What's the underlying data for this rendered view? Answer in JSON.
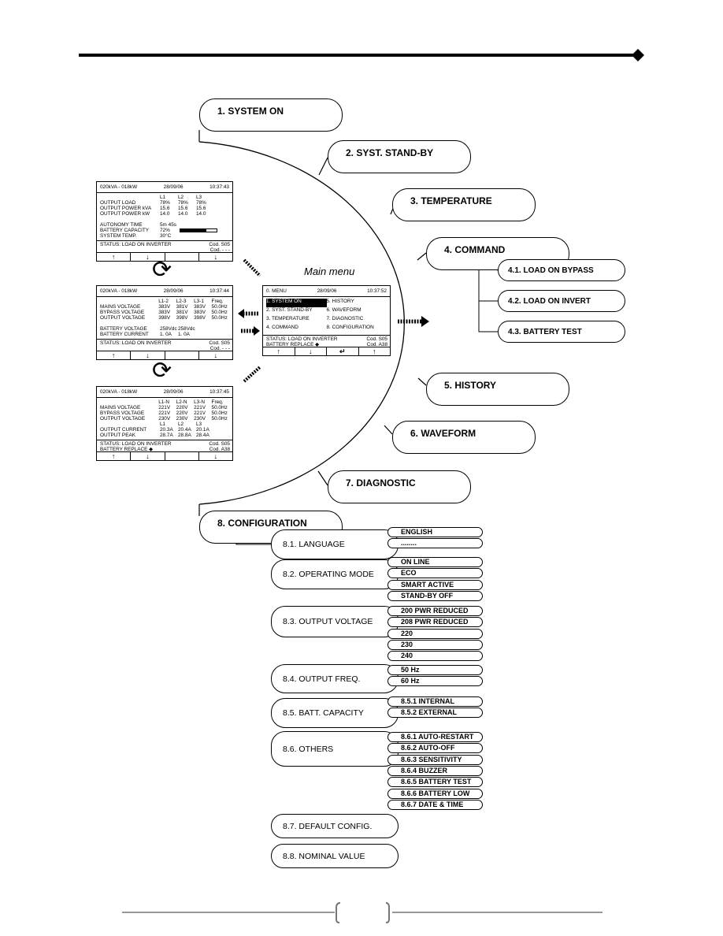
{
  "menu": {
    "title": "Main menu",
    "items": [
      {
        "label": "1. SYSTEM ON"
      },
      {
        "label": "2. SYST. STAND-BY"
      },
      {
        "label": "3. TEMPERATURE"
      },
      {
        "label": "4. COMMAND"
      },
      {
        "label": "5. HISTORY"
      },
      {
        "label": "6. WAVEFORM"
      },
      {
        "label": "7. DIAGNOSTIC"
      },
      {
        "label": "8.  CONFIGURATION"
      }
    ],
    "command_sub": [
      "4.1. LOAD ON BYPASS",
      "4.2. LOAD ON INVERT",
      "4.3. BATTERY TEST"
    ]
  },
  "configuration": [
    {
      "label": "8.1.  LANGUAGE",
      "options": [
        "ENGLISH",
        "........"
      ]
    },
    {
      "label": "8.2.  OPERATING MODE",
      "options": [
        "ON LINE",
        "ECO",
        "SMART ACTIVE",
        "STAND-BY OFF"
      ]
    },
    {
      "label": "8.3.  OUTPUT VOLTAGE",
      "options": [
        "200 PWR REDUCED",
        "208 PWR REDUCED",
        "220",
        "230",
        "240"
      ]
    },
    {
      "label": "8.4.  OUTPUT FREQ.",
      "options": [
        "50 Hz",
        "60 Hz"
      ]
    },
    {
      "label": "8.5.  BATT. CAPACITY",
      "options": [
        "8.5.1 INTERNAL",
        "8.5.2 EXTERNAL"
      ]
    },
    {
      "label": "8.6.  OTHERS",
      "options": [
        "8.6.1 AUTO-RESTART",
        "8.6.2 AUTO-OFF",
        "8.6.3 SENSITIVITY",
        "8.6.4 BUZZER",
        "8.6.5 BATTERY TEST",
        "8.6.6 BATTERY LOW",
        "8.6.7 DATE & TIME"
      ]
    },
    {
      "label": "8.7.  DEFAULT CONFIG.",
      "options": []
    },
    {
      "label": "8.8.  NOMINAL VALUE",
      "options": []
    }
  ],
  "screens": [
    {
      "header": [
        "020kVA - 018kW",
        "28/09/06",
        "10:37:43"
      ],
      "rows": [
        [
          "",
          "L1",
          "L2",
          "L3"
        ],
        [
          "OUTPUT LOAD",
          "78%",
          "78%",
          "78%"
        ],
        [
          "OUTPUT POWER kVA",
          "15.6",
          "15.6",
          "15.6"
        ],
        [
          "OUTPUT POWER kW",
          "14.0",
          "14.0",
          "14.0"
        ],
        [
          ""
        ],
        [
          "AUTONOMY TIME",
          "5m  45s"
        ],
        [
          "BATTERY CAPACITY",
          "72%"
        ],
        [
          "SYSTEM TEMP.",
          "30°C"
        ]
      ],
      "battery_capacity_percent": 72,
      "status": [
        "STATUS:  LOAD ON INVERTER",
        ""
      ],
      "cod": [
        "Cod.  S05",
        "Cod.  - - -"
      ]
    },
    {
      "header": [
        "020kVA - 018kW",
        "28/09/06",
        "10:37:44"
      ],
      "rows": [
        [
          "",
          "L1-2",
          "L2-3",
          "L3-1",
          "Freq."
        ],
        [
          "MAINS   VOLTAGE",
          "383V",
          "381V",
          "383V",
          "50.0Hz"
        ],
        [
          "BYPASS  VOLTAGE",
          "383V",
          "381V",
          "383V",
          "50.0Hz"
        ],
        [
          "OUTPUT  VOLTAGE",
          "398V",
          "398V",
          "398V",
          "50.0Hz"
        ],
        [
          ""
        ],
        [
          "BATTERY VOLTAGE",
          "258Vdc",
          "258Vdc"
        ],
        [
          "BATTERY CURRENT",
          "1. 0A",
          "1. 0A"
        ]
      ],
      "status": [
        "STATUS:  LOAD ON INVERTER",
        ""
      ],
      "cod": [
        "Cod.  S05",
        "Cod.  - - -"
      ]
    },
    {
      "header": [
        "020kVA - 018kW",
        "28/09/06",
        "10:37:45"
      ],
      "rows": [
        [
          "",
          "L1-N",
          "L2-N",
          "L3-N",
          "Freq."
        ],
        [
          "MAINS   VOLTAGE",
          "221V",
          "220V",
          "221V",
          "50.0Hz"
        ],
        [
          "BYPASS  VOLTAGE",
          "221V",
          "220V",
          "221V",
          "50.0Hz"
        ],
        [
          "OUTPUT  VOLTAGE",
          "230V",
          "230V",
          "230V",
          "50.0Hz"
        ],
        [
          "",
          "L1",
          "L2",
          "L3"
        ],
        [
          "OUTPUT  CURRENT",
          "20.3A",
          "20.4A",
          "20.1A"
        ],
        [
          "OUTPUT  PEAK",
          "28.7A",
          "28.8A",
          "28.4A"
        ]
      ],
      "status": [
        "STATUS:  LOAD ON INVERTER",
        "BATTERY REPLACE ◆"
      ],
      "cod": [
        "Cod.  S05",
        "Cod.  A38"
      ]
    }
  ],
  "main_screen": {
    "header": [
      "0. MENU",
      "28/09/06",
      "10:37:52"
    ],
    "rows": [
      [
        "1. SYSTEM ON",
        "5. HISTORY"
      ],
      [
        "2. SYST. STAND-BY",
        "6. WAVEFORM"
      ],
      [
        "3. TEMPERATURE",
        "7. DIAGNOSTIC"
      ],
      [
        "4. COMMAND",
        "8. CONFIGURATION"
      ]
    ],
    "status": [
      "STATUS:  LOAD ON INVERTER",
      "BATTERY REPLACE ◆"
    ],
    "cod": [
      "Cod.  S05",
      "Cod.  A38"
    ]
  },
  "icons": {
    "up": "↑",
    "down": "↓",
    "enter": "↵",
    "cycle": "⟳"
  }
}
